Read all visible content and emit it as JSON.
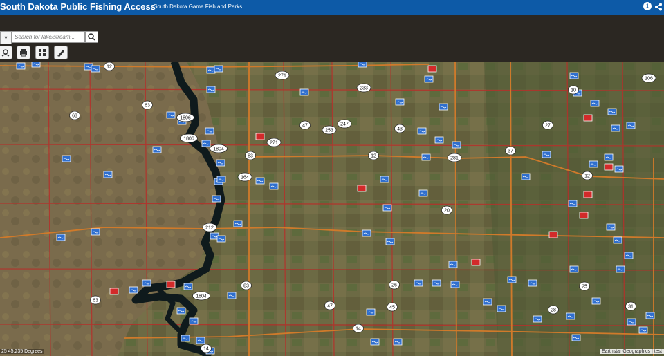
{
  "app": {
    "title": "South Dakota Public Fishing Access",
    "subtitle": "South Dakota Game Fish and Parks"
  },
  "search": {
    "placeholder": "Search for lake/stream..."
  },
  "toolbar": {
    "icons": [
      "locate-icon",
      "print-icon",
      "basemap-gallery-icon",
      "measure-icon"
    ]
  },
  "map": {
    "coordinates": "25 45.235 Degrees",
    "attribution": "Earthstar Geographics | test",
    "highway_labels": [
      "12",
      "271",
      "233",
      "106",
      "10",
      "63",
      "63",
      "1806",
      "1806",
      "1804",
      "83",
      "271",
      "47",
      "253",
      "247",
      "43",
      "12",
      "281",
      "37",
      "27",
      "12",
      "164",
      "20",
      "212",
      "83",
      "26",
      "45",
      "47",
      "14",
      "14",
      "63",
      "1804",
      "28",
      "25",
      "31"
    ],
    "colors": {
      "header": "#0d5aa7",
      "access_marker": "#2f6fcf",
      "special_marker": "#d22a2a",
      "roads": "#b5302a",
      "highways": "#d07a2a",
      "river": "#0f1a1c"
    }
  }
}
